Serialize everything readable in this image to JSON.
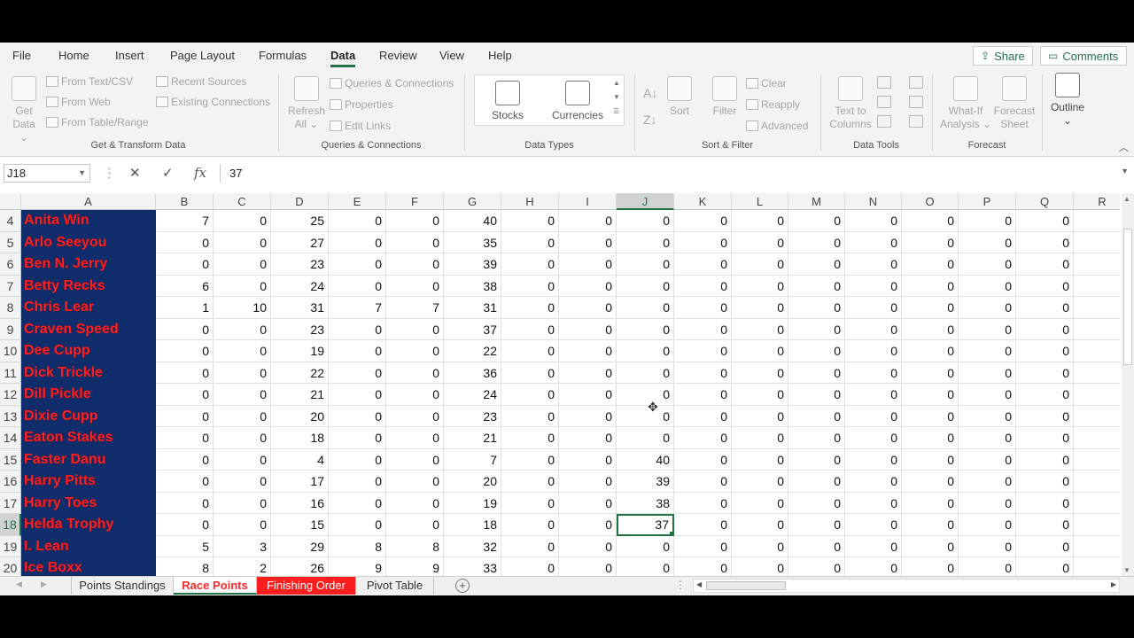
{
  "ribbon_tabs": [
    "File",
    "Home",
    "Insert",
    "Page Layout",
    "Formulas",
    "Data",
    "Review",
    "View",
    "Help"
  ],
  "active_tab": "Data",
  "share_label": "Share",
  "comments_label": "Comments",
  "get_transform": {
    "get_data": "Get",
    "get_data2": "Data",
    "from_text": "From Text/CSV",
    "from_web": "From Web",
    "from_table": "From Table/Range",
    "recent_sources": "Recent Sources",
    "existing_connections": "Existing Connections",
    "group_label": "Get & Transform Data"
  },
  "queries": {
    "refresh": "Refresh",
    "refresh2": "All",
    "queries_connections": "Queries & Connections",
    "properties": "Properties",
    "edit_links": "Edit Links",
    "group_label": "Queries & Connections"
  },
  "data_types": {
    "stocks": "Stocks",
    "currencies": "Currencies",
    "group_label": "Data Types"
  },
  "sort_filter": {
    "sort": "Sort",
    "filter": "Filter",
    "clear": "Clear",
    "reapply": "Reapply",
    "advanced": "Advanced",
    "group_label": "Sort & Filter"
  },
  "data_tools": {
    "text_to_columns": "Text to",
    "text_to_columns2": "Columns",
    "group_label": "Data Tools"
  },
  "forecast": {
    "what_if": "What-If",
    "what_if2": "Analysis",
    "forecast_sheet": "Forecast",
    "forecast_sheet2": "Sheet",
    "group_label": "Forecast"
  },
  "outline": {
    "label": "Outline"
  },
  "formula_bar": {
    "name_box": "J18",
    "cancel": "✕",
    "enter": "✓",
    "fx": "fx",
    "value": "37"
  },
  "columns": [
    "A",
    "B",
    "C",
    "D",
    "E",
    "F",
    "G",
    "H",
    "I",
    "J",
    "K",
    "L",
    "M",
    "N",
    "O",
    "P",
    "Q",
    "R"
  ],
  "selected_cell": {
    "row": "18",
    "col": "J"
  },
  "rows": [
    {
      "num": "4",
      "name": "Anita Win",
      "vals": [
        "7",
        "0",
        "25",
        "0",
        "0",
        "40",
        "0",
        "0",
        "0",
        "0",
        "0",
        "0",
        "0",
        "0",
        "0",
        "0"
      ]
    },
    {
      "num": "5",
      "name": "Arlo Seeyou",
      "vals": [
        "0",
        "0",
        "27",
        "0",
        "0",
        "35",
        "0",
        "0",
        "0",
        "0",
        "0",
        "0",
        "0",
        "0",
        "0",
        "0"
      ]
    },
    {
      "num": "6",
      "name": "Ben N. Jerry",
      "vals": [
        "0",
        "0",
        "23",
        "0",
        "0",
        "39",
        "0",
        "0",
        "0",
        "0",
        "0",
        "0",
        "0",
        "0",
        "0",
        "0"
      ]
    },
    {
      "num": "7",
      "name": "Betty Recks",
      "vals": [
        "6",
        "0",
        "24",
        "0",
        "0",
        "38",
        "0",
        "0",
        "0",
        "0",
        "0",
        "0",
        "0",
        "0",
        "0",
        "0"
      ]
    },
    {
      "num": "8",
      "name": "Chris Lear",
      "vals": [
        "1",
        "10",
        "31",
        "7",
        "7",
        "31",
        "0",
        "0",
        "0",
        "0",
        "0",
        "0",
        "0",
        "0",
        "0",
        "0"
      ]
    },
    {
      "num": "9",
      "name": "Craven Speed",
      "vals": [
        "0",
        "0",
        "23",
        "0",
        "0",
        "37",
        "0",
        "0",
        "0",
        "0",
        "0",
        "0",
        "0",
        "0",
        "0",
        "0"
      ]
    },
    {
      "num": "10",
      "name": "Dee Cupp",
      "vals": [
        "0",
        "0",
        "19",
        "0",
        "0",
        "22",
        "0",
        "0",
        "0",
        "0",
        "0",
        "0",
        "0",
        "0",
        "0",
        "0"
      ]
    },
    {
      "num": "11",
      "name": "Dick Trickle",
      "vals": [
        "0",
        "0",
        "22",
        "0",
        "0",
        "36",
        "0",
        "0",
        "0",
        "0",
        "0",
        "0",
        "0",
        "0",
        "0",
        "0"
      ]
    },
    {
      "num": "12",
      "name": "Dill Pickle",
      "vals": [
        "0",
        "0",
        "21",
        "0",
        "0",
        "24",
        "0",
        "0",
        "0",
        "0",
        "0",
        "0",
        "0",
        "0",
        "0",
        "0"
      ]
    },
    {
      "num": "13",
      "name": "Dixie Cupp",
      "vals": [
        "0",
        "0",
        "20",
        "0",
        "0",
        "23",
        "0",
        "0",
        "0",
        "0",
        "0",
        "0",
        "0",
        "0",
        "0",
        "0"
      ]
    },
    {
      "num": "14",
      "name": "Eaton Stakes",
      "vals": [
        "0",
        "0",
        "18",
        "0",
        "0",
        "21",
        "0",
        "0",
        "0",
        "0",
        "0",
        "0",
        "0",
        "0",
        "0",
        "0"
      ]
    },
    {
      "num": "15",
      "name": "Faster Danu",
      "vals": [
        "0",
        "0",
        "4",
        "0",
        "0",
        "7",
        "0",
        "0",
        "40",
        "0",
        "0",
        "0",
        "0",
        "0",
        "0",
        "0"
      ]
    },
    {
      "num": "16",
      "name": "Harry Pitts",
      "vals": [
        "0",
        "0",
        "17",
        "0",
        "0",
        "20",
        "0",
        "0",
        "39",
        "0",
        "0",
        "0",
        "0",
        "0",
        "0",
        "0"
      ]
    },
    {
      "num": "17",
      "name": "Harry Toes",
      "vals": [
        "0",
        "0",
        "16",
        "0",
        "0",
        "19",
        "0",
        "0",
        "38",
        "0",
        "0",
        "0",
        "0",
        "0",
        "0",
        "0"
      ]
    },
    {
      "num": "18",
      "name": "Helda Trophy",
      "vals": [
        "0",
        "0",
        "15",
        "0",
        "0",
        "18",
        "0",
        "0",
        "37",
        "0",
        "0",
        "0",
        "0",
        "0",
        "0",
        "0"
      ]
    },
    {
      "num": "19",
      "name": "I. Lean",
      "vals": [
        "5",
        "3",
        "29",
        "8",
        "8",
        "32",
        "0",
        "0",
        "0",
        "0",
        "0",
        "0",
        "0",
        "0",
        "0",
        "0"
      ]
    },
    {
      "num": "20",
      "name": "Ice Boxx",
      "vals": [
        "8",
        "2",
        "26",
        "9",
        "9",
        "33",
        "0",
        "0",
        "0",
        "0",
        "0",
        "0",
        "0",
        "0",
        "0",
        "0"
      ]
    }
  ],
  "sheet_tabs": [
    {
      "label": "Points Standings",
      "style": "normal"
    },
    {
      "label": "Race Points",
      "style": "active"
    },
    {
      "label": "Finishing Order",
      "style": "red"
    },
    {
      "label": "Pivot Table",
      "style": "normal"
    }
  ],
  "colors": {
    "excel_green": "#217346",
    "name_cell_bg": "#0f2d6b",
    "name_cell_text": "#ff1e1e",
    "finishing_tab": "#ff1e1e"
  }
}
